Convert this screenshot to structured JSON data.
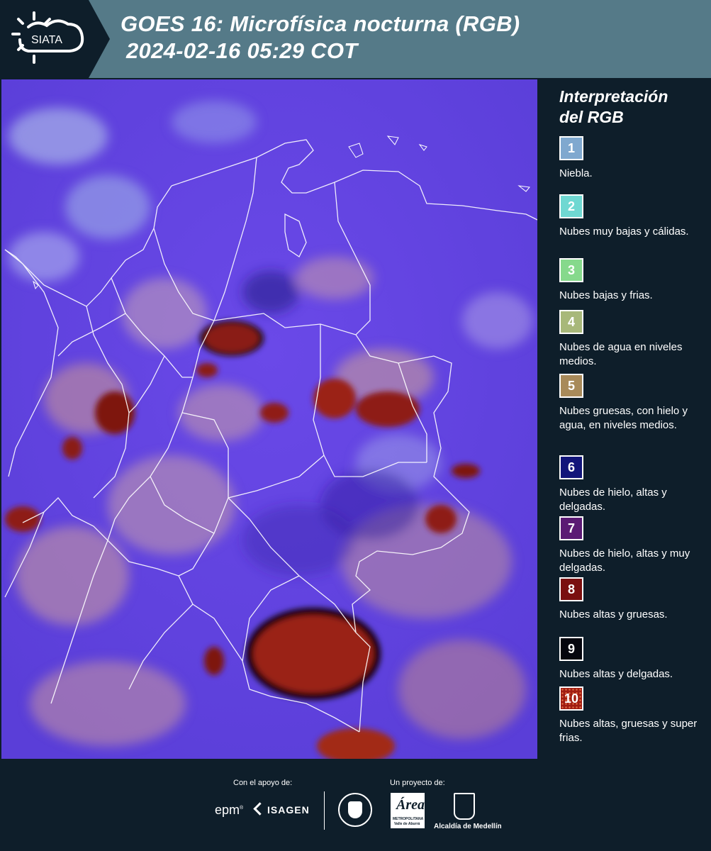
{
  "header": {
    "logo_text": "SIATA",
    "title_line1": "GOES 16: Microfísica nocturna (RGB)",
    "title_line2": "2024-02-16 05:29 COT"
  },
  "legend": {
    "title_line1": "Interpretación",
    "title_line2": "del RGB",
    "items": [
      {
        "number": "1",
        "color": "#7fa8cf",
        "label": "Niebla."
      },
      {
        "number": "2",
        "color": "#6fd8d2",
        "label": "Nubes muy bajas y cálidas."
      },
      {
        "number": "3",
        "color": "#86d98c",
        "label": "Nubes bajas y frias."
      },
      {
        "number": "4",
        "color": "#a8b87a",
        "label": "Nubes de agua en niveles medios."
      },
      {
        "number": "5",
        "color": "#a88a5a",
        "label": "Nubes gruesas, con hielo y agua, en niveles medios."
      },
      {
        "number": "6",
        "color": "#12157a",
        "label": "Nubes de hielo, altas y delgadas."
      },
      {
        "number": "7",
        "color": "#5b1a74",
        "label": "Nubes de hielo, altas y muy delgadas."
      },
      {
        "number": "8",
        "color": "#7a0f0f",
        "label": "Nubes altas y gruesas."
      },
      {
        "number": "9",
        "color": "#05060e",
        "label": "Nubes altas y delgadas."
      },
      {
        "number": "10",
        "color": "#a01c12",
        "label": "Nubes altas, gruesas y super frias."
      }
    ]
  },
  "footer": {
    "support_label": "Con el apoyo de:",
    "project_label": "Un proyecto de:",
    "epm": "epm",
    "isagen": "ISAGEN",
    "area_metro": "Área",
    "area_metro_sub": "METROPOLITANA",
    "area_metro_sub2": "Valle de Aburrá",
    "alcaldia": "Alcaldía de Medellín"
  }
}
